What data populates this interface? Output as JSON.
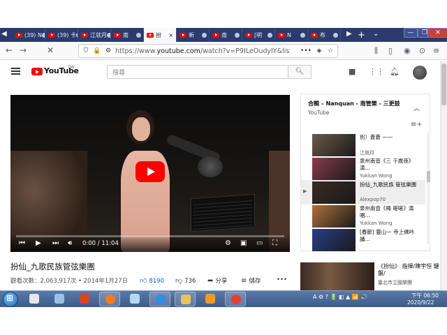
{
  "browser": {
    "tabs": [
      {
        "label": "(39) N",
        "type": "youtube"
      },
      {
        "label": "(39) 卡",
        "type": "youtube"
      },
      {
        "label": "江就月",
        "type": "youtube"
      },
      {
        "label": "南",
        "type": "youtube"
      },
      {
        "label": "扮",
        "type": "youtube",
        "active": true
      },
      {
        "label": "新",
        "type": "youtube"
      },
      {
        "label": "南",
        "type": "youtube"
      },
      {
        "label": "[明",
        "type": "youtube"
      },
      {
        "label": "N",
        "type": "youtube"
      },
      {
        "label": "布",
        "type": "youtube"
      }
    ],
    "tab_close_symbol": "×",
    "new_tab_symbol": "+",
    "tab_list_symbol": "⌄",
    "url": "https://www.youtube.com/watch?v=P9ILeOudyIY&list=RDg",
    "url_domain": "youtube.com",
    "url_prefix": "https://www.",
    "url_suffix": "/watch?v=P9ILeOudyIY&list=RDg",
    "page_actions": "•••"
  },
  "youtube": {
    "logo_text": "YouTube",
    "logo_region": "TW",
    "search_placeholder": "搜尋",
    "video": {
      "title": "扮仙_九歌民族管弦樂團",
      "views": "觀看次數：2,063,917次",
      "date": "• 2014年1月27日",
      "likes": "8190",
      "dislikes": "736",
      "share_label": "分享",
      "save_label": "儲存",
      "more_label": "•••",
      "current_time": "0:00",
      "duration": "11:04",
      "progress": 0.0
    },
    "playlist": {
      "title": "合輯 – Nanquan - 南管樂 - 三更鼓",
      "channel": "YouTube",
      "items": [
        {
          "title": "別）蒼蒼 ——",
          "channel": "江就月",
          "current": false,
          "thumb": "#6b5a4a"
        },
        {
          "title": "泉州南音《三 千歲夜》演…",
          "channel": "Yukkan Wong",
          "current": false,
          "thumb": "#8a3a4a"
        },
        {
          "title": "扮仙_九歌民族 管弦樂團",
          "channel": "Alexpop70",
          "current": true,
          "thumb": "#3a2a22"
        },
        {
          "title": "泉州南音《梅 嗟嗟》演唱…",
          "channel": "Yukkan Wong",
          "current": false,
          "thumb": "#b0703a"
        },
        {
          "title": "[春節] 靈山一 寺上佛吟誦…",
          "channel": "",
          "current": false,
          "thumb": "#2a3e8a"
        }
      ]
    },
    "recommendation": {
      "title": "《扮仙》 指揮/陳宇恒 鍵盤/",
      "subtitle": "臺北市立國樂團 "
    }
  },
  "taskbar": {
    "apps": [
      "windows-media-icon",
      "network-icon",
      "powerpoint-icon",
      "firefox-icon",
      "file-icon",
      "ie-icon",
      "folder-icon",
      "media-player-icon",
      "chrome-icon"
    ],
    "tray_text": "A ⚙ ? 🔋 ◧ ▲ 📶 🔊",
    "time": "下午 06:50",
    "date": "2020/9/22"
  },
  "colors": {
    "youtube_red": "#ff0000",
    "tab_strip": "#2b3b6e",
    "like_blue": "#065fd4"
  }
}
